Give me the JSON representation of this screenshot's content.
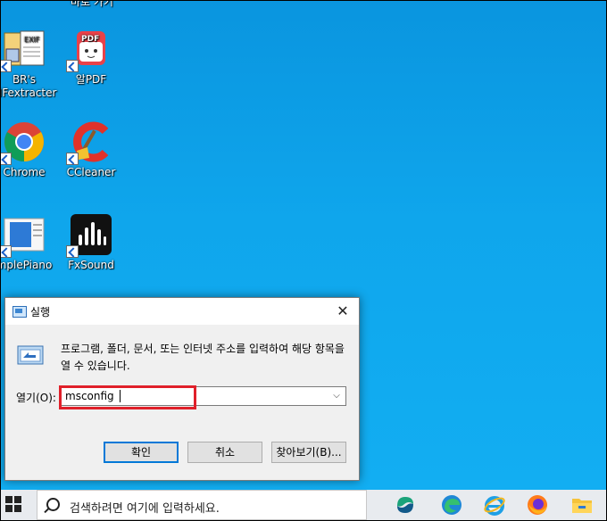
{
  "desktop": {
    "top_label": "바로 가기",
    "icons": [
      {
        "label_line1": "BR's",
        "label_line2": "XIFextracter",
        "icon": "exif-extracter-icon"
      },
      {
        "label_line1": "알PDF",
        "label_line2": "",
        "icon": "alpdf-icon"
      },
      {
        "label_line1": "Chrome",
        "label_line2": "",
        "icon": "chrome-icon"
      },
      {
        "label_line1": "CCleaner",
        "label_line2": "",
        "icon": "ccleaner-icon"
      },
      {
        "label_line1": "mplePiano",
        "label_line2": "",
        "icon": "simplepiano-icon"
      },
      {
        "label_line1": "FxSound",
        "label_line2": "",
        "icon": "fxsound-icon"
      }
    ]
  },
  "dialog": {
    "title": "실행",
    "close_glyph": "✕",
    "description": "프로그램, 폴더, 문서, 또는 인터넷 주소를 입력하여 해당 항목을 열 수 있습니다.",
    "open_label": "열기(O):",
    "open_value": "msconfig",
    "buttons": {
      "ok": "확인",
      "cancel": "취소",
      "browse": "찾아보기(B)..."
    },
    "highlight_color": "#e0202a"
  },
  "taskbar": {
    "search_placeholder": "검색하려면 여기에 입력하세요.",
    "apps": [
      "start-icon",
      "copilot-icon",
      "edge-icon",
      "ie-icon",
      "firefox-icon",
      "file-explorer-icon"
    ]
  }
}
